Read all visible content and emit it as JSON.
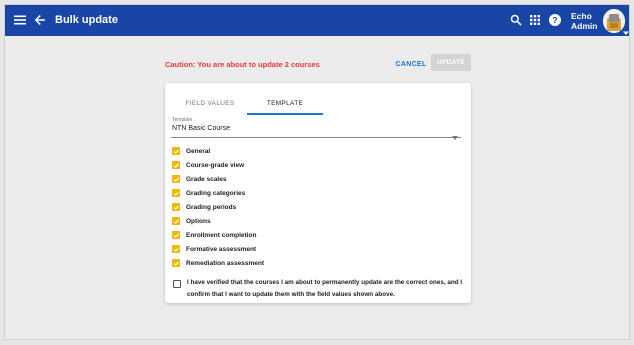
{
  "header": {
    "title": "Bulk update",
    "user_line1": "Echo",
    "user_line2": "Admin",
    "color": "#1845a6"
  },
  "icons": {
    "menu": "menu-icon",
    "back": "arrow-back-icon",
    "search": "search-icon",
    "apps": "apps-grid-icon",
    "help": "help-icon",
    "avatar": "user-avatar",
    "avatar_caret": "caret-down-icon"
  },
  "action_bar": {
    "caution": "Caution: You are about to update 2 courses",
    "caution_color": "#e53935",
    "cancel_label": "CANCEL",
    "update_label": "UPDATE"
  },
  "tabs": [
    {
      "label": "FIELD VALUES",
      "active": false
    },
    {
      "label": "TEMPLATE",
      "active": true
    }
  ],
  "template_select": {
    "label": "Template",
    "value": "NTN Basic Course"
  },
  "options": [
    {
      "label": "General",
      "checked": true
    },
    {
      "label": "Course-grade view",
      "checked": true
    },
    {
      "label": "Grade scales",
      "checked": true
    },
    {
      "label": "Grading categories",
      "checked": true
    },
    {
      "label": "Grading periods",
      "checked": true
    },
    {
      "label": "Options",
      "checked": true
    },
    {
      "label": "Enrollment completion",
      "checked": true
    },
    {
      "label": "Formative assessment",
      "checked": true
    },
    {
      "label": "Remediation assessment",
      "checked": true
    }
  ],
  "verify": {
    "text": "I have verified that the courses I am about to permanently update are the correct ones, and I confirm that I want to update them with the field values shown above.",
    "checked": false
  },
  "checkbox_color": "#f5b400"
}
